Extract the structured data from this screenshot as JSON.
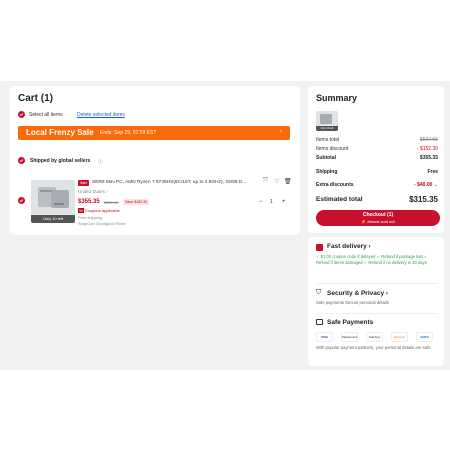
{
  "cart": {
    "title": "Cart (1)",
    "select_all": "Select all items",
    "delete_selected": "Delete selected items",
    "promo": {
      "name": "Local Frenzy Sale",
      "ends": "Ends: Sep 29, 02:59 EST"
    },
    "shipping_title": "Shipped by global sellers",
    "item": {
      "badge": "Sale",
      "title": "SER8 Mini PC, AMD Ryzen 7 8745HS(8C/16T, up to 4.9GHz), 32GB D...",
      "ship_from": "United States",
      "price": "$355.35",
      "original_price": "$507.65",
      "save": "Save $152.30",
      "coupons": "Coupons applicable",
      "free_shipping": "Free shipping",
      "store": "SnapCart Goodgood Store",
      "stock": "Only 10 left",
      "quantity": "1"
    }
  },
  "summary": {
    "title": "Summary",
    "items_total_label": "Items total",
    "items_total": "$507.65",
    "items_discount_label": "Items discount",
    "items_discount": "- $152.30",
    "subtotal_label": "Subtotal",
    "subtotal": "$355.35",
    "shipping_label": "Shipping",
    "shipping": "Free",
    "extra_discounts_label": "Extra discounts",
    "extra_discounts": "- $40.00",
    "estimated_total_label": "Estimated total",
    "estimated_total": "$315.35",
    "checkout": "Checkout (1)",
    "checkout_sub": "Almost sold out",
    "thumb_label": "Only 10 left"
  },
  "delivery": {
    "title": "Fast delivery",
    "text": "✓ $1.00 coupon code if delayed  ✓ Refund if package lost  ✓ Refund if items damaged  ✓ Refund if no delivery in 30 days"
  },
  "security": {
    "title": "Security & Privacy",
    "text": "Safe payments Secure personal details"
  },
  "payments": {
    "title": "Safe Payments",
    "text": "With popular payment partners, your personal details are safe.",
    "methods": [
      "VISA",
      "Mastercard",
      "SafeKey",
      "Discover",
      "AMEX"
    ]
  }
}
